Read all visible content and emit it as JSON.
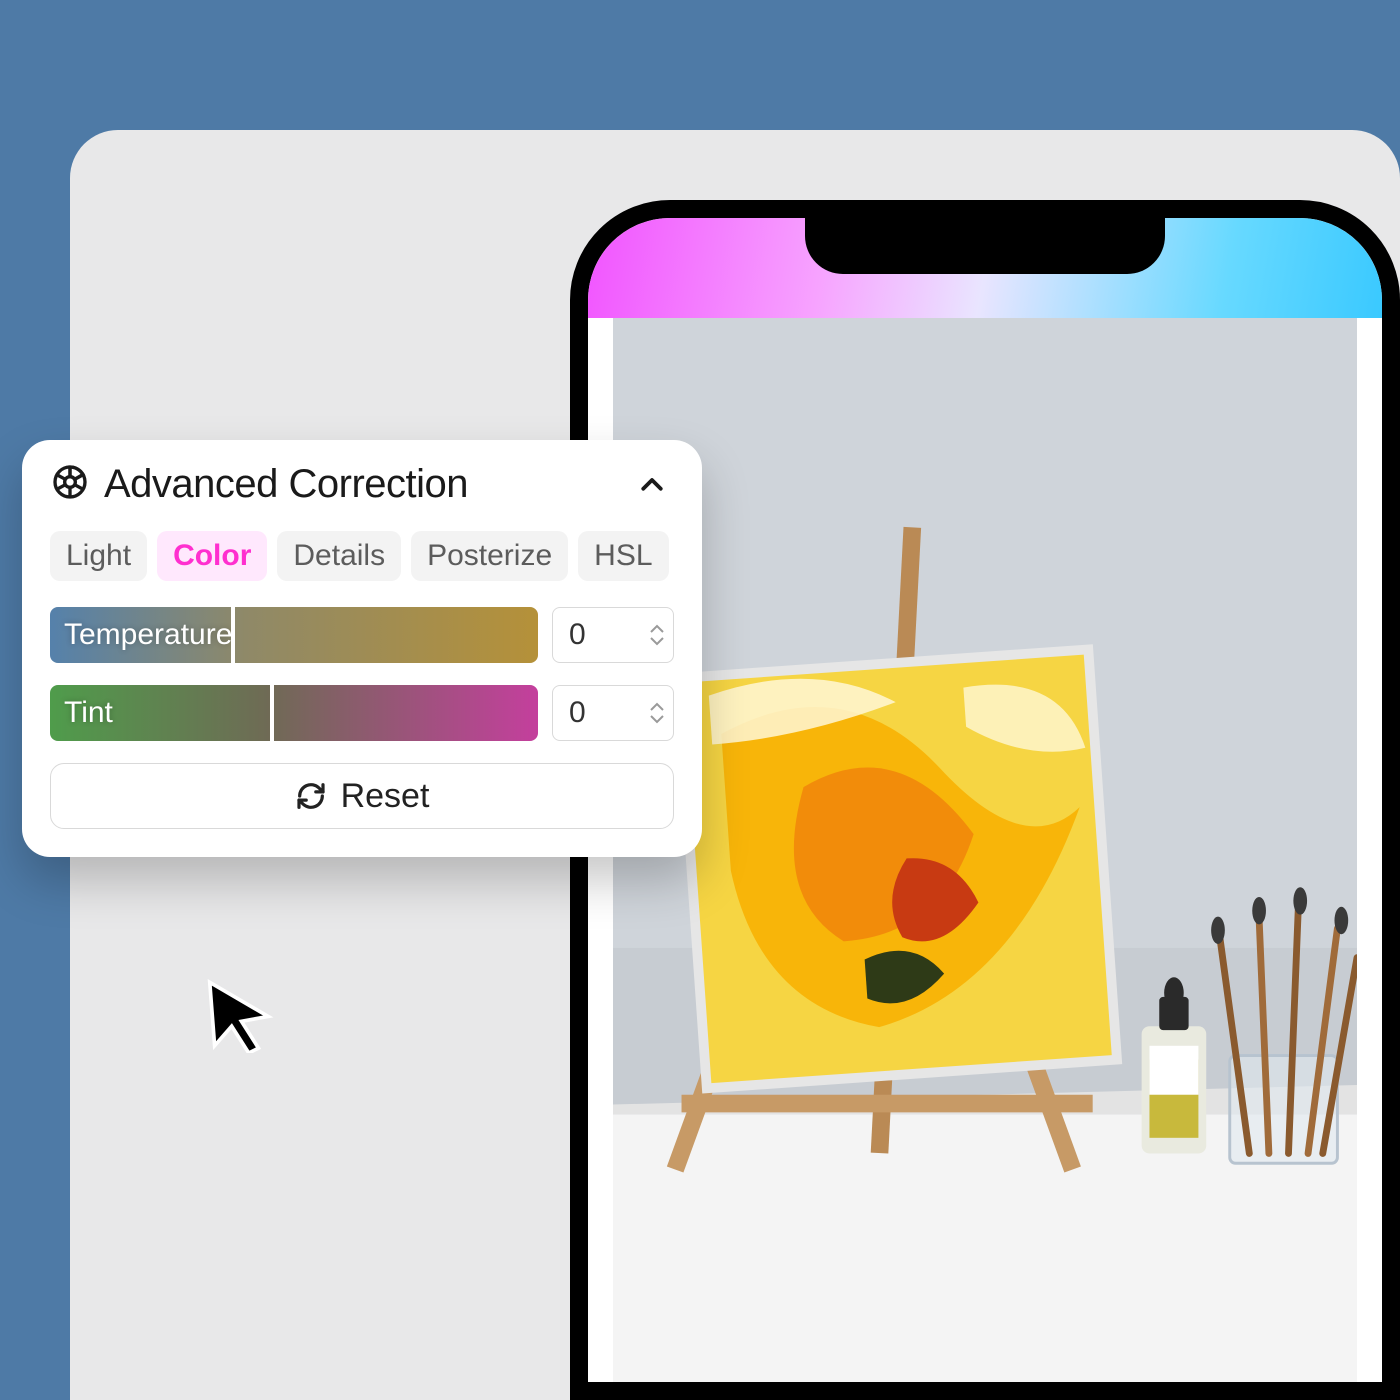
{
  "panel": {
    "title": "Advanced Correction",
    "tabs": [
      "Light",
      "Color",
      "Details",
      "Posterize",
      "HSL"
    ],
    "active_tab": "Color",
    "sliders": {
      "temperature": {
        "label": "Temperature",
        "value": 0
      },
      "tint": {
        "label": "Tint",
        "value": 0
      }
    },
    "reset_label": "Reset"
  },
  "icons": {
    "gear": "gear-icon",
    "collapse": "chevron-up-icon",
    "reset": "refresh-icon",
    "cursor": "cursor-icon"
  }
}
